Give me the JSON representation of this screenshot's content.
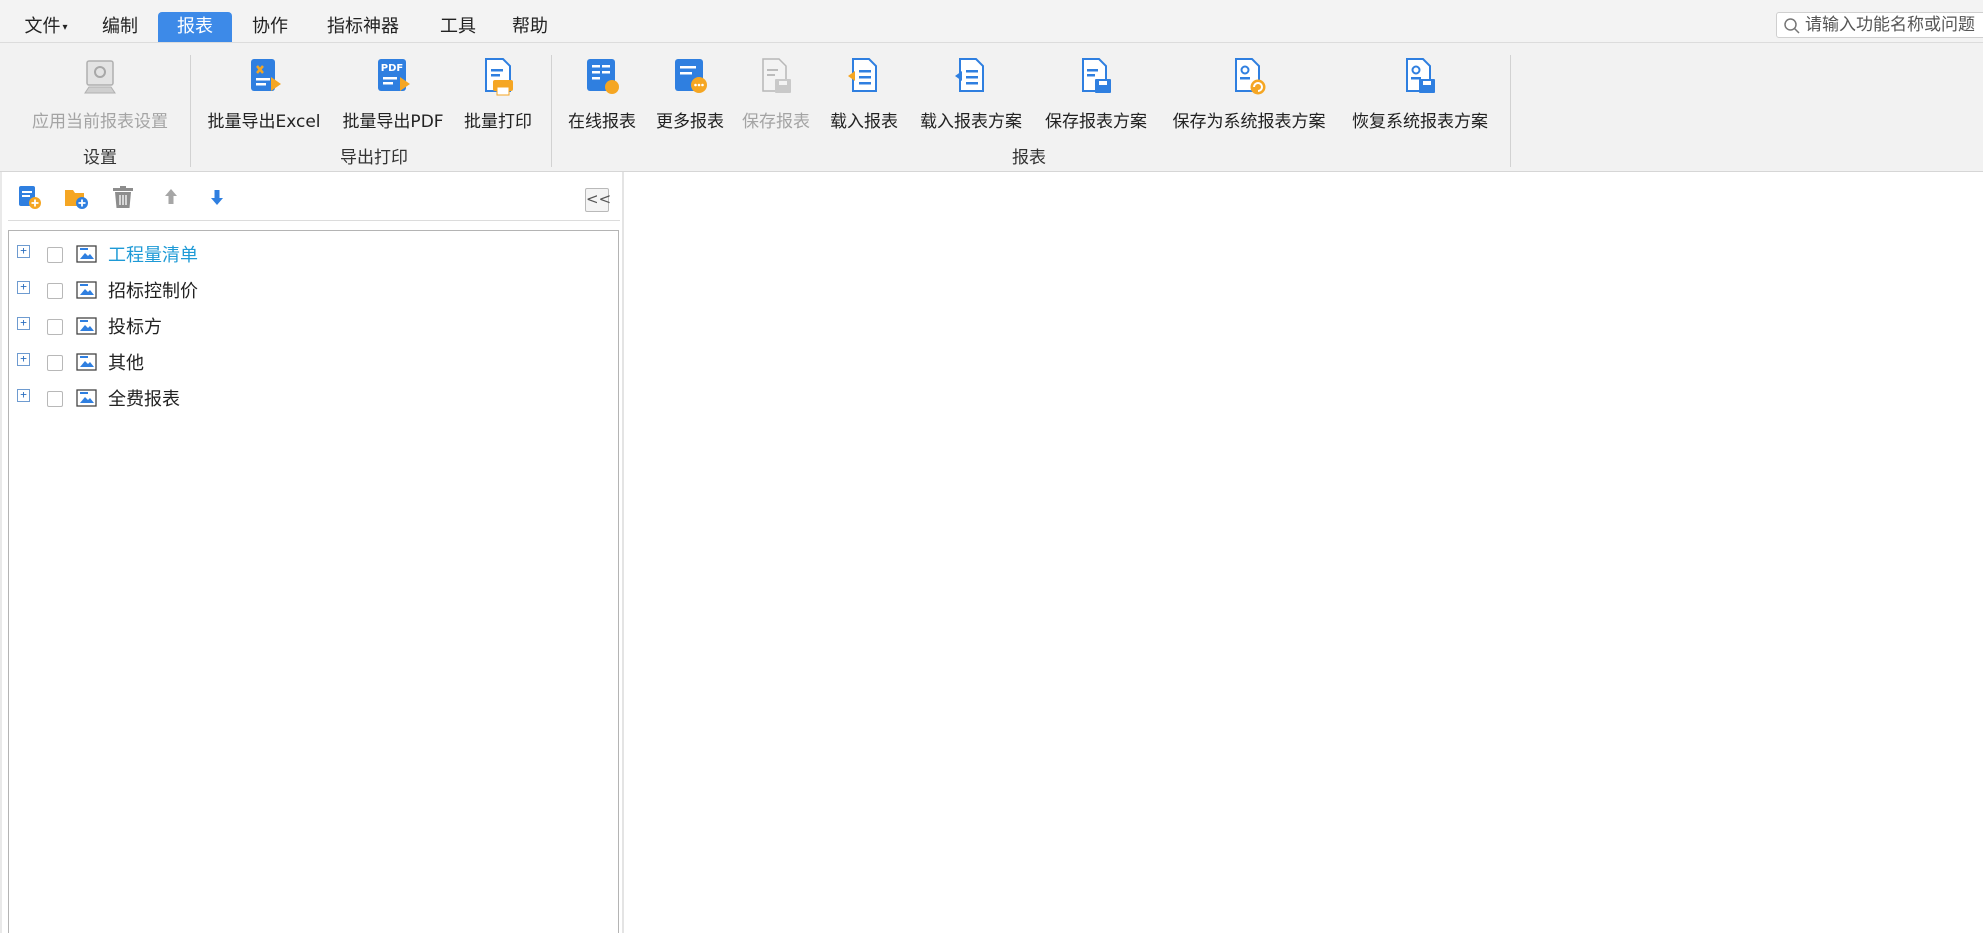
{
  "menu": {
    "file": "文件",
    "edit": "编制",
    "report": "报表",
    "collab": "协作",
    "indicator": "指标神器",
    "tools": "工具",
    "help": "帮助"
  },
  "search": {
    "placeholder": "请输入功能名称或问题"
  },
  "ribbon": {
    "apply_settings": "应用当前报表设置",
    "batch_excel": "批量导出Excel",
    "batch_pdf": "批量导出PDF",
    "batch_print": "批量打印",
    "online_report": "在线报表",
    "more_reports": "更多报表",
    "save_report": "保存报表",
    "load_report": "载入报表",
    "load_scheme": "载入报表方案",
    "save_scheme": "保存报表方案",
    "save_system_scheme": "保存为系统报表方案",
    "restore_system_scheme": "恢复系统报表方案",
    "group_settings": "设置",
    "group_export": "导出打印",
    "group_report": "报表"
  },
  "panel": {
    "collapse_glyph": "<<"
  },
  "tree": [
    {
      "label": "工程量清单"
    },
    {
      "label": "招标控制价"
    },
    {
      "label": "投标方"
    },
    {
      "label": "其他"
    },
    {
      "label": "全费报表"
    }
  ],
  "colors": {
    "accent": "#3d8ae8",
    "selected_text": "#1e9ad6",
    "icon_blue": "#2f7fe0",
    "icon_orange": "#f5a623"
  }
}
